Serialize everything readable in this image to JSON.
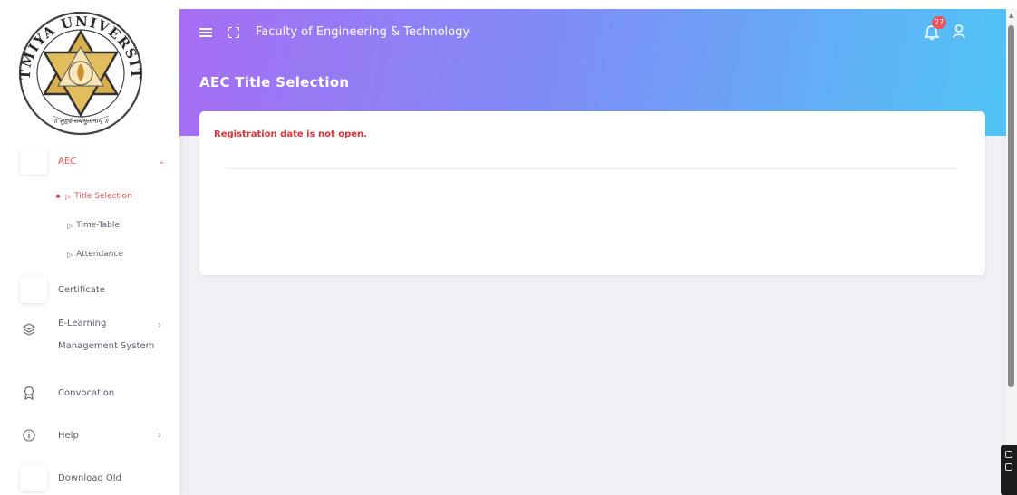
{
  "header": {
    "faculty": "Faculty of Engineering & Technology",
    "page_title": "AEC Title Selection",
    "notification_count": "27",
    "gradient": [
      "#a76df3",
      "#7f8cf7",
      "#4fc5f5"
    ]
  },
  "logo": {
    "text_top": "ATMIYA UNIVERSITY",
    "text_bottom": "॥ सुहृदं सर्वभूतानाम् ॥"
  },
  "sidebar": {
    "aec": {
      "label": "AEC",
      "chevron": "⌄"
    },
    "aec_sub": [
      {
        "label": "Title Selection",
        "active": true
      },
      {
        "label": "Time-Table",
        "active": false
      },
      {
        "label": "Attendance",
        "active": false
      }
    ],
    "certificate": {
      "label": "Certificate"
    },
    "elearning": {
      "label_line1": "E-Learning",
      "label_line2": "Management System",
      "chevron": "›"
    },
    "convocation": {
      "label": "Convocation"
    },
    "help": {
      "label": "Help",
      "chevron": "›"
    },
    "download": {
      "label": "Download Old"
    }
  },
  "content": {
    "message": "Registration date is not open.",
    "message_color": "#e0313b"
  },
  "colors": {
    "accent": "#e8505b"
  }
}
